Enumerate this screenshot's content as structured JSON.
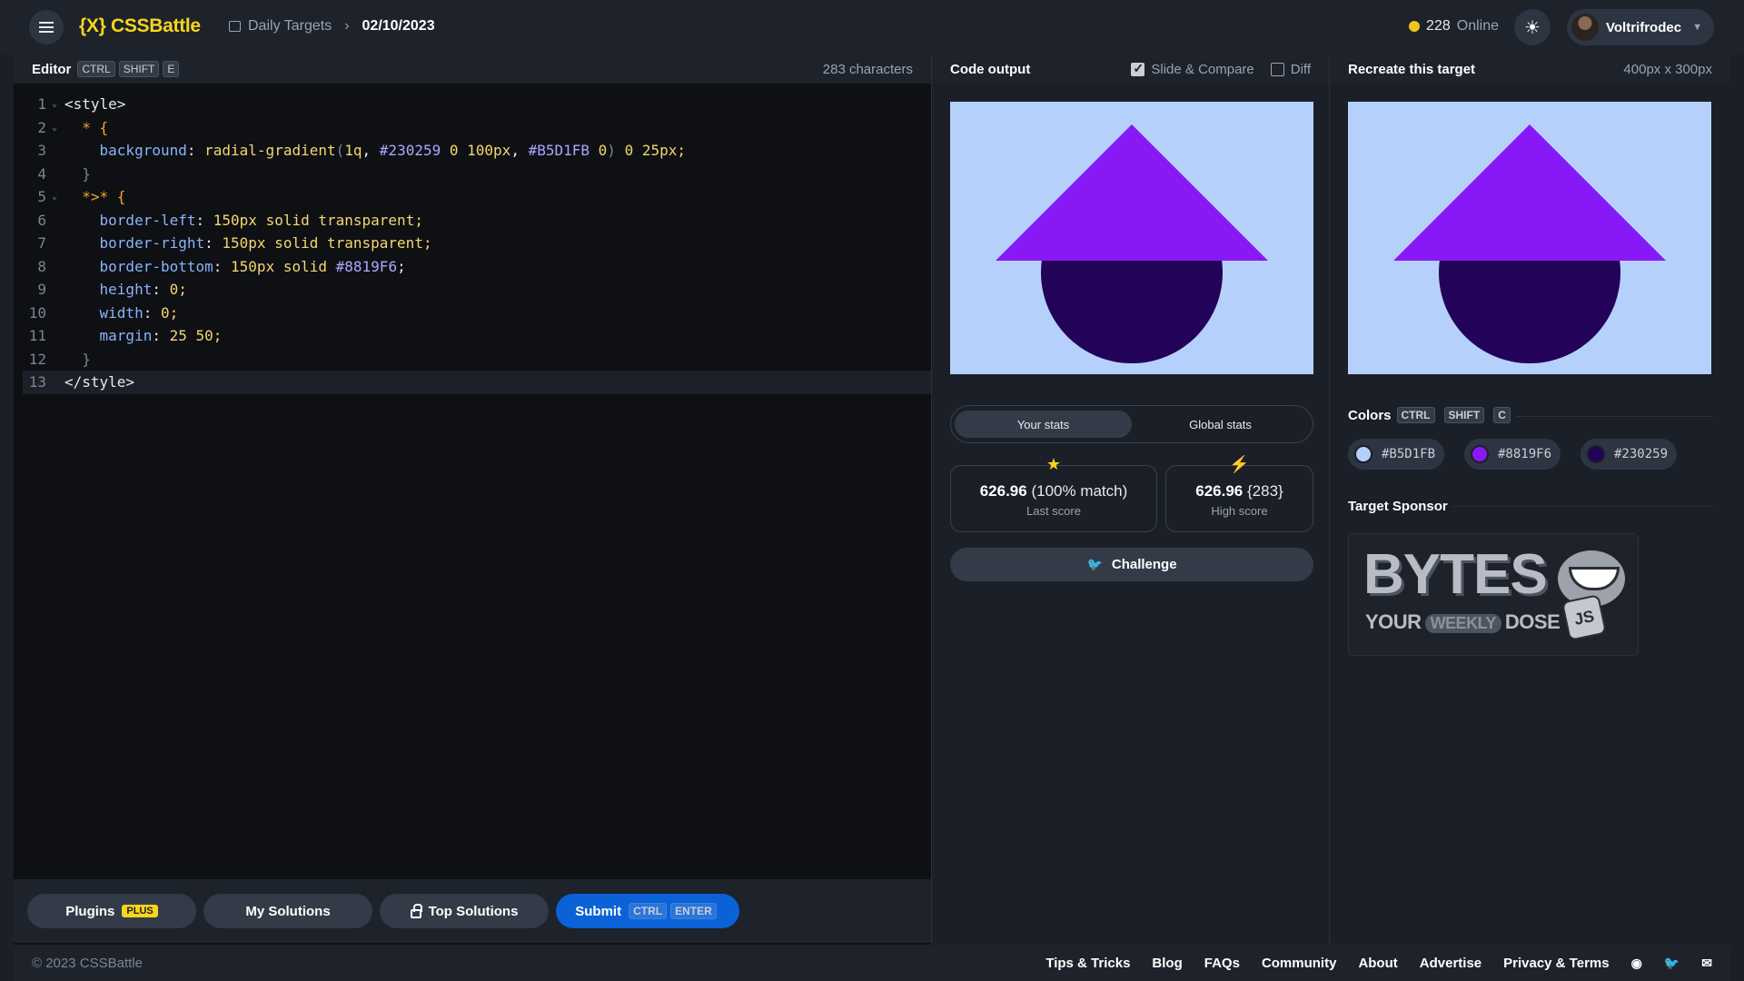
{
  "header": {
    "logo": "{X} CSSBattle",
    "breadcrumb_parent": "Daily Targets",
    "breadcrumb_current": "02/10/2023",
    "online_count": "228",
    "online_label": "Online",
    "username": "Voltrifrodec"
  },
  "editor": {
    "title": "Editor",
    "shortcut": [
      "CTRL",
      "SHIFT",
      "E"
    ],
    "char_count": "283 characters",
    "lines": [
      {
        "n": "1",
        "fold": true
      },
      {
        "n": "2",
        "fold": true
      },
      {
        "n": "3",
        "fold": false
      },
      {
        "n": "4",
        "fold": false
      },
      {
        "n": "5",
        "fold": true
      },
      {
        "n": "6",
        "fold": false
      },
      {
        "n": "7",
        "fold": false
      },
      {
        "n": "8",
        "fold": false
      },
      {
        "n": "9",
        "fold": false
      },
      {
        "n": "10",
        "fold": false
      },
      {
        "n": "11",
        "fold": false
      },
      {
        "n": "12",
        "fold": false
      },
      {
        "n": "13",
        "fold": false
      }
    ],
    "code_text": {
      "l1_open": "<style>",
      "l2": "* {",
      "l3_prop": "background",
      "l3_fn": "radial-gradient",
      "l3_a": "1q",
      "l3_hex1": "#230259",
      "l3_b": "0 100px",
      "l3_hex2": "#B5D1FB",
      "l3_c": "0",
      "l3_d": "0 25px;",
      "l4": "}",
      "l5": "*>* {",
      "l6_prop": "border-left",
      "l6_val": "150px solid transparent;",
      "l7_prop": "border-right",
      "l7_val": "150px solid transparent;",
      "l8_prop": "border-bottom",
      "l8_val": "150px solid",
      "l8_hex": "#8819F6",
      "l9_prop": "height",
      "l9_val": "0;",
      "l10_prop": "width",
      "l10_val": "0;",
      "l11_prop": "margin",
      "l11_val": "25 50;",
      "l12": "}",
      "l13_close": "</style>"
    },
    "buttons": {
      "plugins": "Plugins",
      "plugins_badge": "PLUS",
      "my_solutions": "My Solutions",
      "top_solutions": "Top Solutions",
      "submit": "Submit",
      "submit_keys": [
        "CTRL",
        "ENTER"
      ]
    }
  },
  "output": {
    "title": "Code output",
    "slide_compare": "Slide & Compare",
    "slide_compare_checked": true,
    "diff": "Diff",
    "diff_checked": false,
    "tabs": [
      "Your stats",
      "Global stats"
    ],
    "active_tab": 0,
    "last_score_value": "626.96",
    "last_score_extra": "(100% match)",
    "last_score_label": "Last score",
    "high_score_value": "626.96",
    "high_score_extra": "{283}",
    "high_score_label": "High score",
    "challenge": "Challenge"
  },
  "target": {
    "title": "Recreate this target",
    "dims": "400px x 300px",
    "colors_title": "Colors",
    "colors_shortcut": [
      "CTRL",
      "SHIFT",
      "C"
    ],
    "colors": [
      {
        "hex": "#B5D1FB",
        "color": "#b5d1fb"
      },
      {
        "hex": "#8819F6",
        "color": "#8819f6"
      },
      {
        "hex": "#230259",
        "color": "#230259"
      }
    ],
    "sponsor_title": "Target Sponsor",
    "sponsor": {
      "big": "BYTES",
      "small_a": "YOUR",
      "small_b": "WEEKLY",
      "small_c": "DOSE OF",
      "js": "JS"
    }
  },
  "footer": {
    "copyright": "© 2023 CSSBattle",
    "links": [
      "Tips & Tricks",
      "Blog",
      "FAQs",
      "Community",
      "About",
      "Advertise",
      "Privacy & Terms"
    ]
  }
}
